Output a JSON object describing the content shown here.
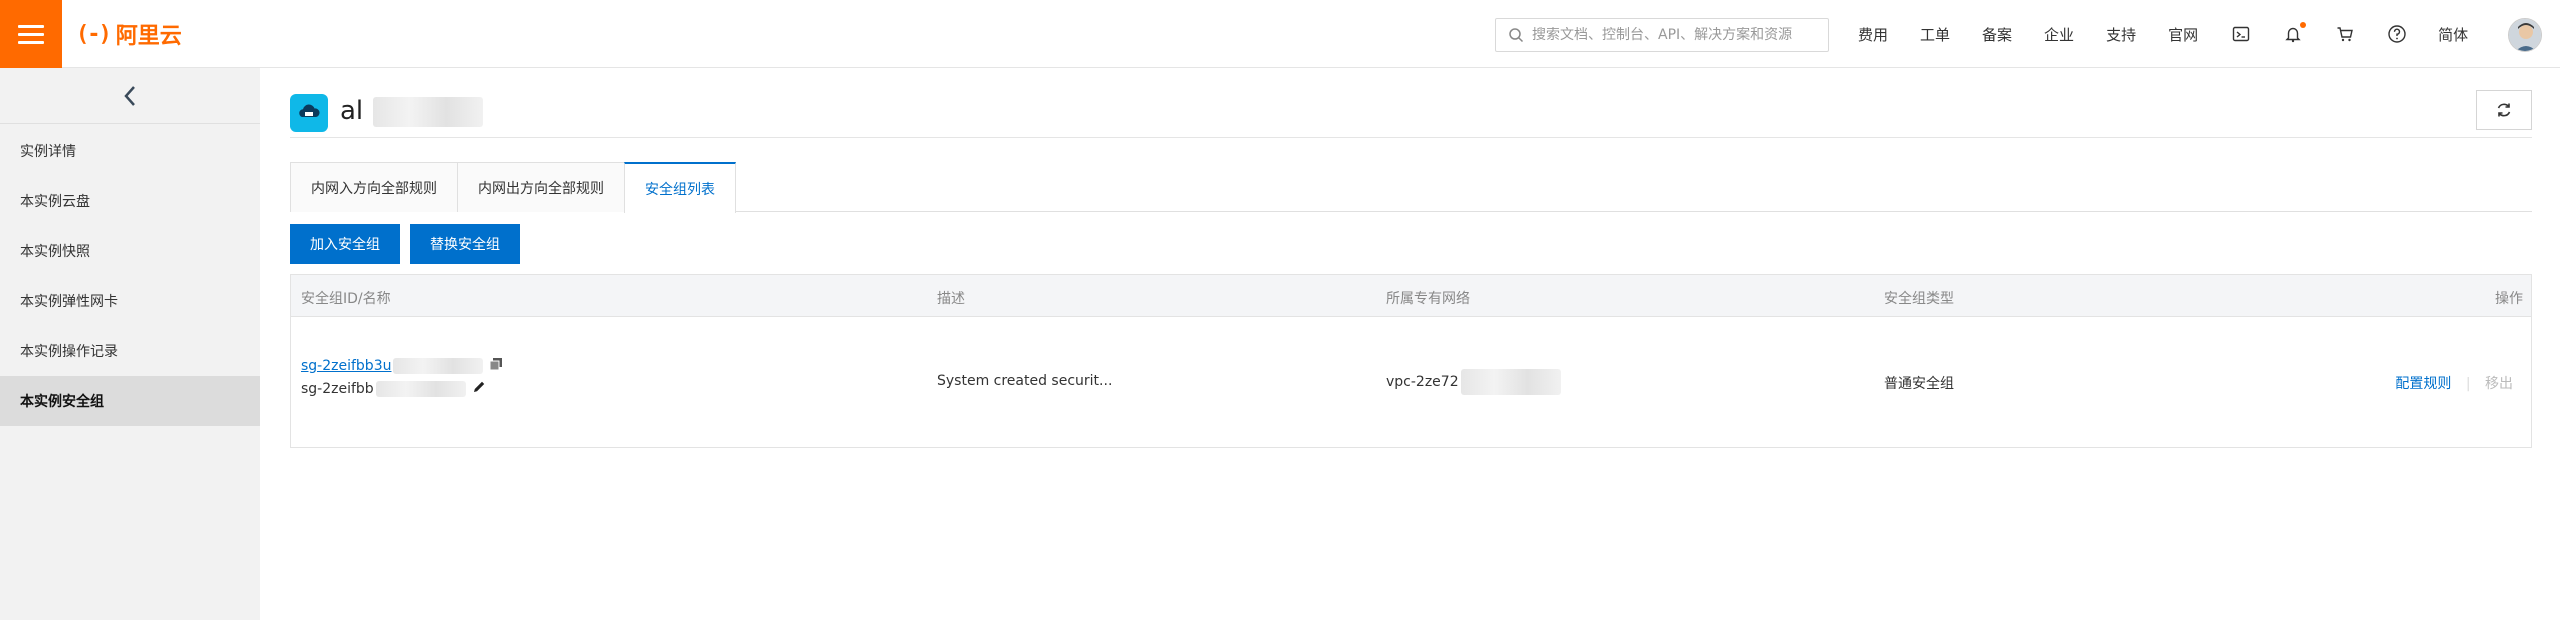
{
  "topbar": {
    "logo_text": "阿里云",
    "logo_mark": "(-)",
    "search_placeholder": "搜索文档、控制台、API、解决方案和资源",
    "nav": [
      "费用",
      "工单",
      "备案",
      "企业",
      "支持",
      "官网"
    ],
    "lang": "简体",
    "icons": [
      "terminal-icon",
      "bell-icon",
      "cart-icon",
      "help-icon"
    ],
    "accent": "#ff6a00"
  },
  "sidebar": {
    "items": [
      {
        "label": "实例详情",
        "active": false
      },
      {
        "label": "本实例云盘",
        "active": false
      },
      {
        "label": "本实例快照",
        "active": false
      },
      {
        "label": "本实例弹性网卡",
        "active": false
      },
      {
        "label": "本实例操作记录",
        "active": false
      },
      {
        "label": "本实例安全组",
        "active": true
      }
    ]
  },
  "header": {
    "title_prefix": "al"
  },
  "tabs": [
    {
      "label": "内网入方向全部规则",
      "active": false
    },
    {
      "label": "内网出方向全部规则",
      "active": false
    },
    {
      "label": "安全组列表",
      "active": true
    }
  ],
  "buttons": {
    "join": "加入安全组",
    "replace": "替换安全组"
  },
  "table": {
    "headers": [
      "安全组ID/名称",
      "描述",
      "所属专有网络",
      "安全组类型",
      "操作"
    ],
    "rows": [
      {
        "id": "sg-2zeifbb3u",
        "name": "sg-2zeifbb",
        "description": "System created securit...",
        "vpc": "vpc-2ze72",
        "type": "普通安全组",
        "op_config": "配置规则",
        "op_remove": "移出"
      }
    ]
  },
  "colors": {
    "primary": "#0070cc",
    "brand": "#ff6a00"
  }
}
